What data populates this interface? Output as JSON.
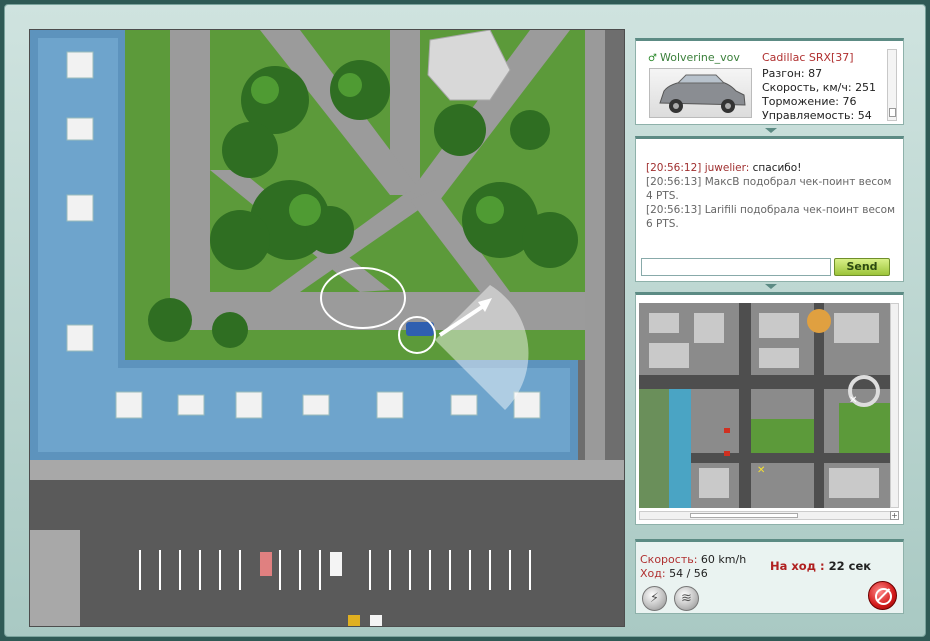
{
  "player": {
    "username": "Wolverine_vov",
    "car_name": "Cadillac SRX[37]",
    "stats": [
      {
        "label": "Разгон:",
        "value": "87"
      },
      {
        "label": "Скорость, км/ч:",
        "value": "251"
      },
      {
        "label": "Торможение:",
        "value": "76"
      },
      {
        "label": "Управляемость:",
        "value": "54"
      }
    ]
  },
  "chat": {
    "messages": [
      {
        "time": "[20:56:12]",
        "nick": "juwelier:",
        "text": "спасибо!"
      },
      {
        "time": "[20:56:13]",
        "nick": "",
        "text": "МаксВ подобрал чек-поинт весом 4 PTS."
      },
      {
        "time": "[20:56:13]",
        "nick": "",
        "text": "Larifili подобрала чек-поинт весом 6 PTS."
      }
    ],
    "input_value": "",
    "send_label": "Send"
  },
  "status": {
    "speed_label": "Скорость:",
    "speed_value": "60 km/h",
    "move_label": "Ход:",
    "move_value": "54 / 56",
    "turn_label": "На ход :",
    "turn_value": "22 сек"
  },
  "icons": {
    "gender": "male-icon",
    "boost": "lightning-icon",
    "signal": "signal-icon",
    "stop": "stop-icon"
  },
  "colors": {
    "accent_red": "#b03030",
    "send_green": "#9cc43a",
    "panel_border": "#5c8b84"
  }
}
